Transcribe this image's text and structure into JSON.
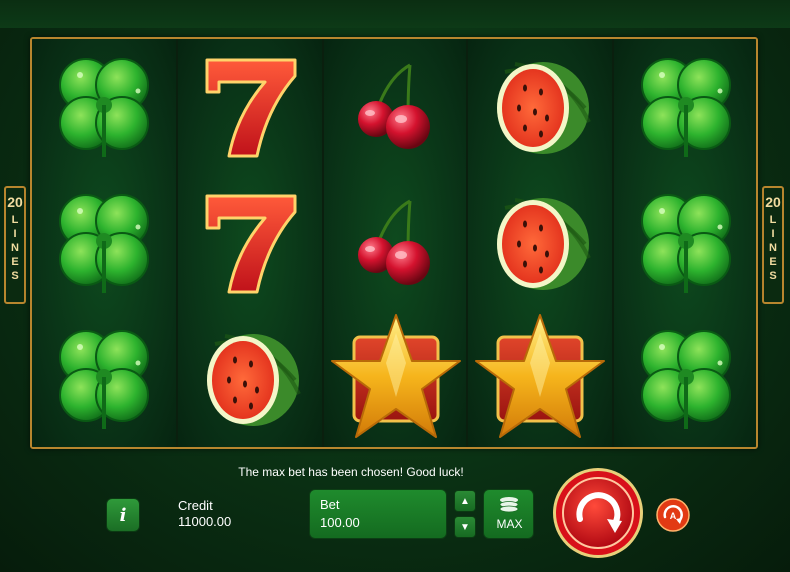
{
  "game": {
    "lines_left": {
      "number": "20",
      "word": "LINES"
    },
    "lines_right": {
      "number": "20",
      "word": "LINES"
    },
    "reels": [
      [
        "clover",
        "clover",
        "clover"
      ],
      [
        "seven",
        "seven",
        "watermelon"
      ],
      [
        "cherry",
        "cherry",
        "star"
      ],
      [
        "watermelon",
        "watermelon",
        "star"
      ],
      [
        "clover",
        "clover",
        "clover"
      ]
    ]
  },
  "message": "The max bet has been chosen! Good luck!",
  "controls": {
    "info_label": "i",
    "credit_label": "Credit",
    "credit_value": "11000.00",
    "bet_label": "Bet",
    "bet_value": "100.00",
    "bet_up": "▲",
    "bet_down": "▼",
    "max_label": "MAX"
  },
  "colors": {
    "gold_frame": "#b8862e",
    "button_green": "#1f8b2d",
    "spin_red": "#d8101a"
  }
}
